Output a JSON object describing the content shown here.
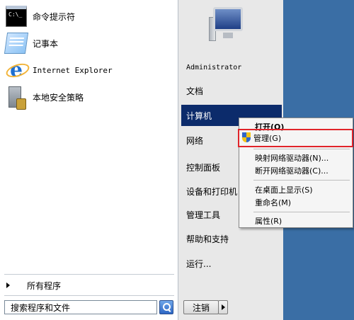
{
  "pinned": [
    {
      "label": "命令提示符",
      "icon": "command-prompt-icon"
    },
    {
      "label": "记事本",
      "icon": "notepad-icon"
    },
    {
      "label": "Internet Explorer",
      "icon": "internet-explorer-icon"
    },
    {
      "label": "本地安全策略",
      "icon": "local-security-policy-icon"
    }
  ],
  "all_programs": "所有程序",
  "search": {
    "value": "搜索程序和文件"
  },
  "right_pane": {
    "user": "Administrator",
    "items": [
      "文档",
      "计算机",
      "网络",
      "控制面板",
      "设备和打印机",
      "管理工具",
      "帮助和支持",
      "运行..."
    ],
    "log_off": "注销"
  },
  "context_menu": {
    "items": [
      "打开(O)",
      "管理(G)",
      "映射网络驱动器(N)...",
      "断开网络驱动器(C)...",
      "在桌面上显示(S)",
      "重命名(M)",
      "属性(R)"
    ]
  },
  "colors": {
    "desktop": "#3a6ea5",
    "highlight": "#0c2b6b",
    "focus_box": "#e0242a"
  }
}
